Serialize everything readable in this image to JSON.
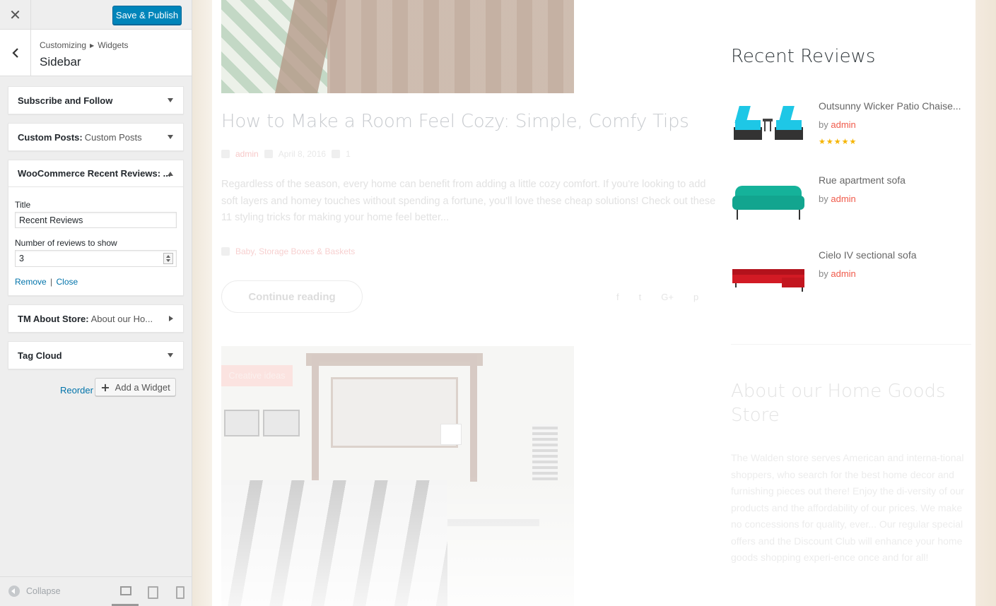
{
  "customizer": {
    "close_label": "✕",
    "publish_label": "Save & Publish",
    "breadcrumb": [
      "Customizing",
      "Widgets"
    ],
    "section_title": "Sidebar",
    "widgets": [
      {
        "title": "Subscribe and Follow",
        "subtitle": "",
        "state": "collapsed"
      },
      {
        "title": "Custom Posts:",
        "subtitle": "Custom Posts",
        "state": "collapsed"
      },
      {
        "title": "WooCommerce Recent Reviews: ...",
        "subtitle": "",
        "state": "open"
      },
      {
        "title": "TM About Store:",
        "subtitle": "About our Ho...",
        "state": "collapsed"
      },
      {
        "title": "Tag Cloud",
        "subtitle": "",
        "state": "collapsed"
      }
    ],
    "open_widget": {
      "title_label": "Title",
      "title_value": "Recent Reviews",
      "count_label": "Number of reviews to show",
      "count_value": "3",
      "remove_label": "Remove",
      "close_label": "Close",
      "separator": "|"
    },
    "reorder_label": "Reorder",
    "add_widget_label": "Add a Widget",
    "collapse_label": "Collapse",
    "devices": [
      "desktop",
      "tablet",
      "mobile"
    ],
    "accent_color": "#0085ba",
    "link_color": "#0073aa"
  },
  "preview": {
    "post": {
      "title": "How to Make a Room Feel Cozy: Simple, Comfy Tips",
      "author": "admin",
      "date": "April 8, 2016",
      "comments": "1",
      "excerpt": "Regardless of the season, every home can benefit from adding a little cozy comfort. If you're looking to add soft layers and homey touches without spending a fortune, you'll love these cheap solutions! Check out these 11 styling tricks for making your home feel better...",
      "tags": "Baby, Storage Boxes & Baskets",
      "continue_label": "Continue reading",
      "share_icons": [
        "f",
        "t",
        "G+",
        "p"
      ]
    },
    "post2_badge": "Creative ideas",
    "sidebar": {
      "recent_reviews_title": "Recent Reviews",
      "reviews": [
        {
          "name": "Outsunny Wicker Patio Chaise...",
          "by": "by",
          "author": "admin",
          "stars": "★★★★★"
        },
        {
          "name": "Rue apartment sofa",
          "by": "by",
          "author": "admin",
          "stars": ""
        },
        {
          "name": "Cielo IV sectional sofa",
          "by": "by",
          "author": "admin",
          "stars": ""
        }
      ],
      "about_title": "About our Home Goods Store",
      "about_text": "The Walden store serves American and interna-tional shoppers, who search for the best home decor and furnishing pieces out there! Enjoy the di-versity of our products and the affordability of our prices. We make no concessions for quality, ever... Our regular special offers and the Discount Club will enhance your home goods shopping experi-ence once and for all!"
    }
  }
}
